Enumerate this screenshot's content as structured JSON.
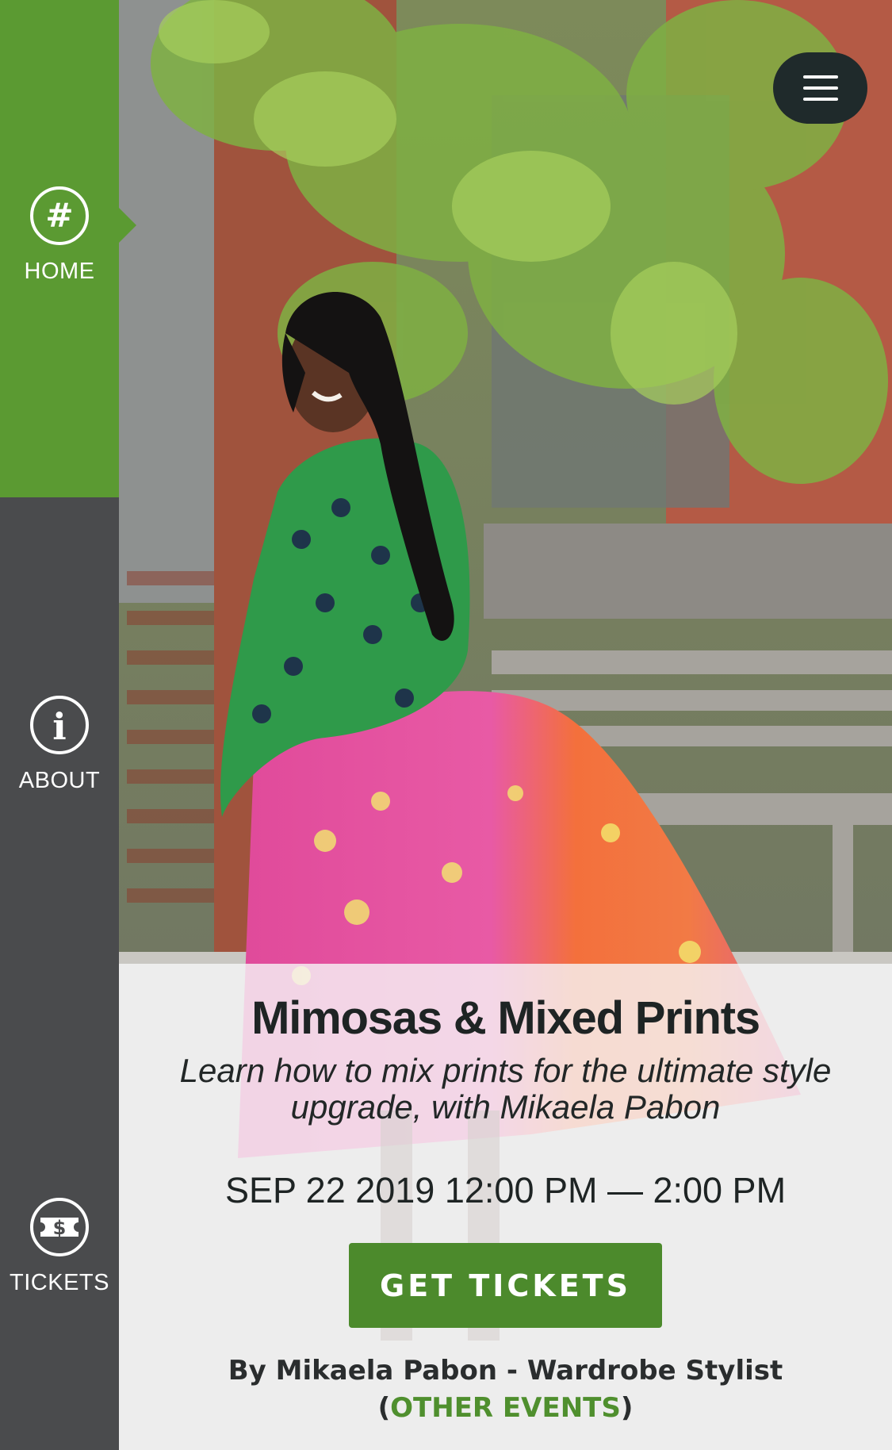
{
  "colors": {
    "brand_green": "#5b9a32",
    "button_green": "#4c8a2c",
    "link_green": "#4f8f2e",
    "sidebar_dark": "#4a4b4d",
    "menu_button_bg": "#1f2a2b",
    "text_dark": "#1e2424"
  },
  "sidebar": {
    "items": [
      {
        "label": "HOME",
        "icon": "hashtag-icon",
        "active": true
      },
      {
        "label": "ABOUT",
        "icon": "info-icon",
        "active": false
      },
      {
        "label": "TICKETS",
        "icon": "ticket-dollar-icon",
        "active": false
      }
    ]
  },
  "header": {
    "menu_icon": "hamburger-menu-icon"
  },
  "hero": {
    "image": "photo of a smiling woman with long braids wearing a green patterned blouse and a pink and orange floral pleated skirt, on a leafy brick street"
  },
  "event": {
    "title": "Mimosas & Mixed Prints",
    "subtitle": "Learn how to mix prints for the ultimate style upgrade, with Mikaela Pabon",
    "date": "SEP 22 2019",
    "time_range": "12:00 PM — 2:00 PM",
    "tickets_button": "GET TICKETS",
    "byline_prefix": "By Mikaela Pabon - Wardrobe Stylist (",
    "byline_link": "OTHER EVENTS",
    "byline_suffix": ")"
  }
}
